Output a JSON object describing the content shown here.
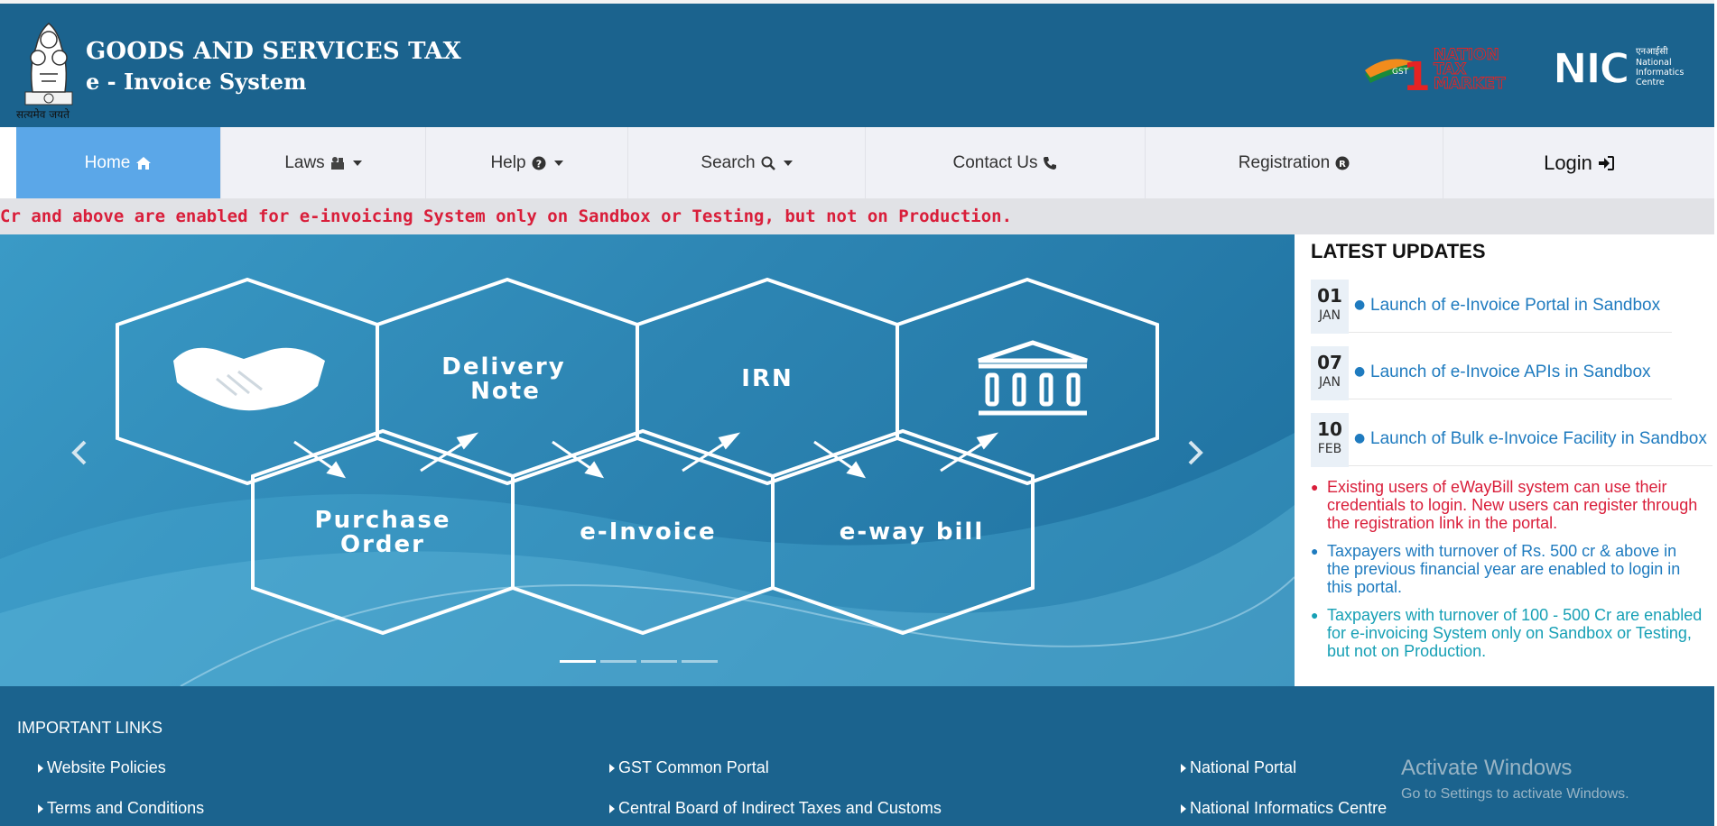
{
  "header": {
    "title": "GOODS AND SERVICES TAX",
    "subtitle": "e - Invoice System",
    "motto": "सत्यमेव जयते",
    "gst_logo_text": [
      "GST",
      "1",
      "NATION",
      "TAX",
      "MARKET"
    ],
    "nic_logo_text": [
      "NIC",
      "एनआईसी",
      "National",
      "Informatics",
      "Centre"
    ],
    "colors": {
      "header_bg": "#1b638e",
      "nav_active": "#5ba7e8",
      "alert": "#d91e3a"
    }
  },
  "nav": {
    "home": "Home",
    "laws": "Laws",
    "help": "Help",
    "search": "Search",
    "contact": "Contact Us",
    "registration": "Registration",
    "login": "Login"
  },
  "marquee": {
    "text": "Cr and above are enabled for e-invoicing System only on Sandbox or Testing, but not on Production."
  },
  "slider": {
    "labels": {
      "delivery1": "Delivery",
      "delivery2": "Note",
      "irn": "IRN",
      "purchase1": "Purchase",
      "purchase2": "Order",
      "einvoice": "e-Invoice",
      "eway": "e-way bill"
    },
    "icons": [
      "handshake-icon",
      "bank-icon"
    ],
    "prev_icon": "chevron-left-icon",
    "next_icon": "chevron-right-icon",
    "active_slide": 1,
    "slide_count": 4
  },
  "updates": {
    "heading": "LATEST UPDATES",
    "items": [
      {
        "day": "01",
        "month": "JAN",
        "text": "Launch of e-Invoice Portal in Sandbox"
      },
      {
        "day": "07",
        "month": "JAN",
        "text": "Launch of e-Invoice APIs in Sandbox"
      },
      {
        "day": "10",
        "month": "FEB",
        "text": "Launch of Bulk e-Invoice Facility in Sandbox"
      }
    ],
    "notices": [
      {
        "lines": [
          "Existing users of eWayBill system can use their",
          "credentials to login. New users can register through",
          "the registration link in the portal."
        ],
        "color": "#d91e3a"
      },
      {
        "lines": [
          "Taxpayers with turnover of Rs. 500 cr & above in",
          "the previous financial year are enabled to login in",
          "this portal."
        ],
        "color": "#1f7bbf"
      },
      {
        "lines": [
          "Taxpayers with turnover of 100 - 500 Cr are enabled",
          "for e-invoicing System only on Sandbox or Testing,",
          "but not on Production."
        ],
        "color": "#17a0b5"
      }
    ]
  },
  "footer": {
    "heading": "IMPORTANT LINKS",
    "links": [
      "Website Policies",
      "GST Common Portal",
      "National Portal",
      "Terms and Conditions",
      "Central Board of Indirect Taxes and Customs",
      "National Informatics Centre"
    ]
  },
  "watermark": {
    "line1": "Activate Windows",
    "line2": "Go to Settings to activate Windows."
  }
}
